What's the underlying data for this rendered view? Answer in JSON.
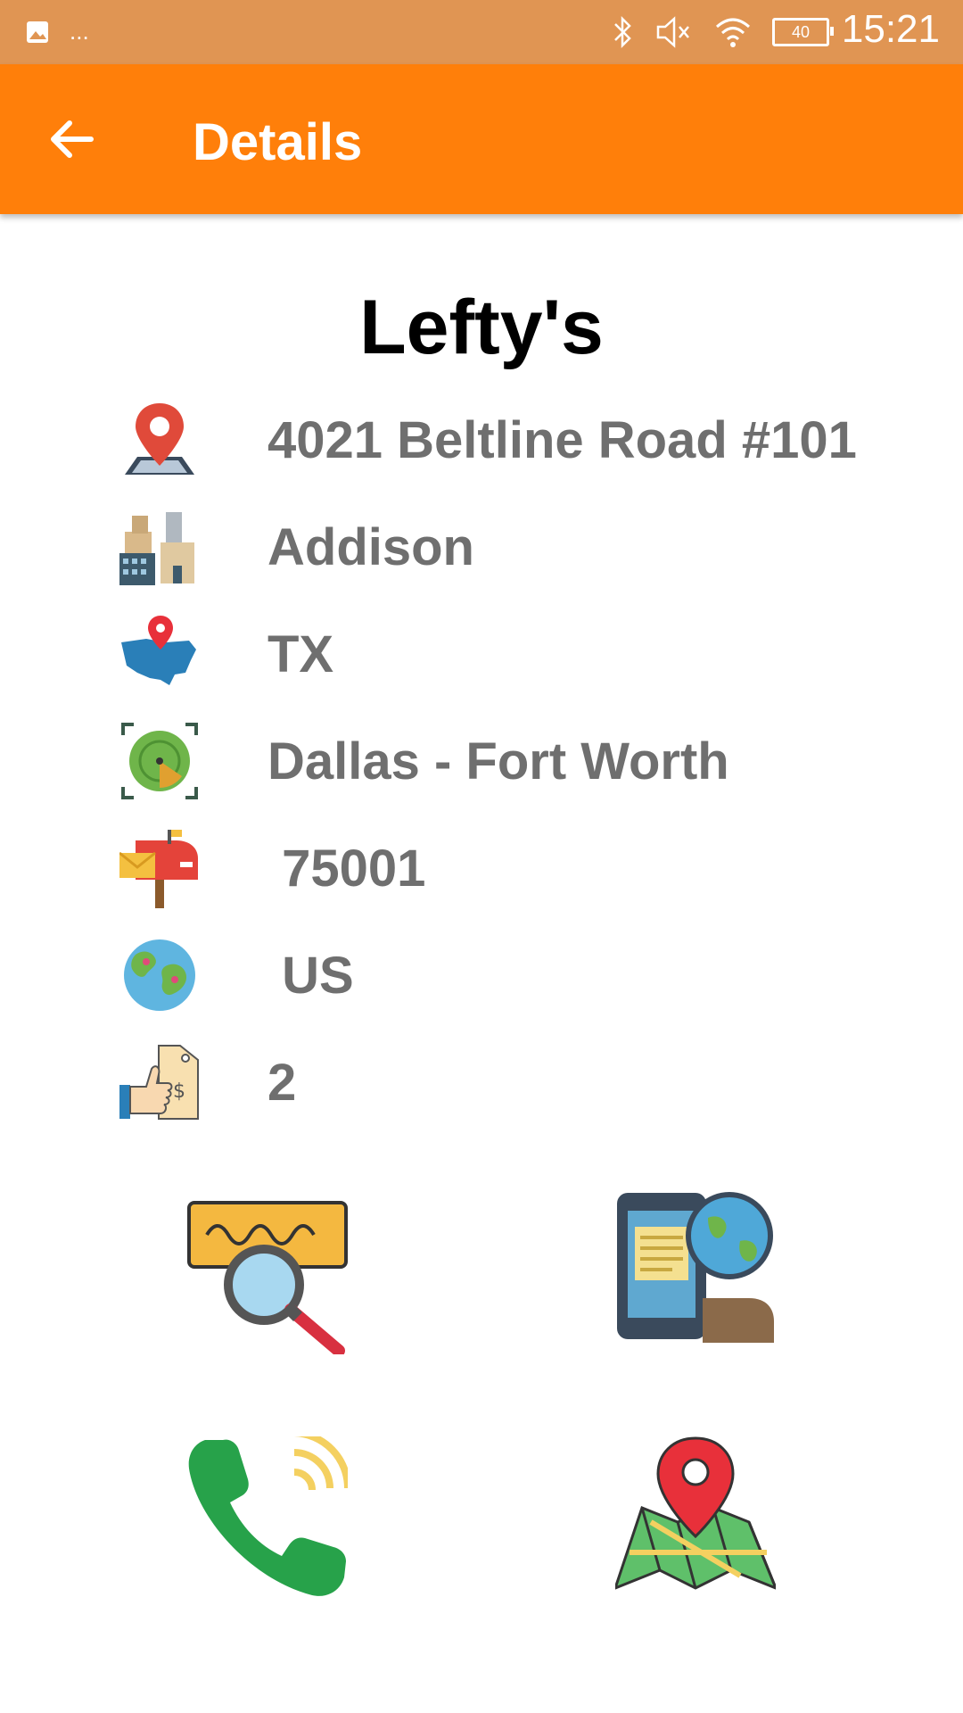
{
  "status_bar": {
    "time": "15:21",
    "battery": "40",
    "overflow": "...",
    "icons": [
      "image-icon",
      "bluetooth-icon",
      "mute-icon",
      "wifi-icon",
      "battery-icon"
    ]
  },
  "app_bar": {
    "title": "Details",
    "back_icon": "arrow-back-icon"
  },
  "place": {
    "name": "Lefty's",
    "address": "4021 Beltline Road #101",
    "city": "Addison",
    "state": "TX",
    "metro": "Dallas - Fort Worth",
    "zip": " 75001",
    "country": " US",
    "price_level": "2"
  },
  "actions": [
    {
      "name": "search-web",
      "icon": "search-magnifier-icon"
    },
    {
      "name": "website",
      "icon": "mobile-globe-icon"
    },
    {
      "name": "call",
      "icon": "phone-icon"
    },
    {
      "name": "map",
      "icon": "map-pin-icon"
    }
  ],
  "colors": {
    "status_bar": "#E09553",
    "app_bar": "#FF7F0A",
    "info_text": "#6f6f6f"
  }
}
